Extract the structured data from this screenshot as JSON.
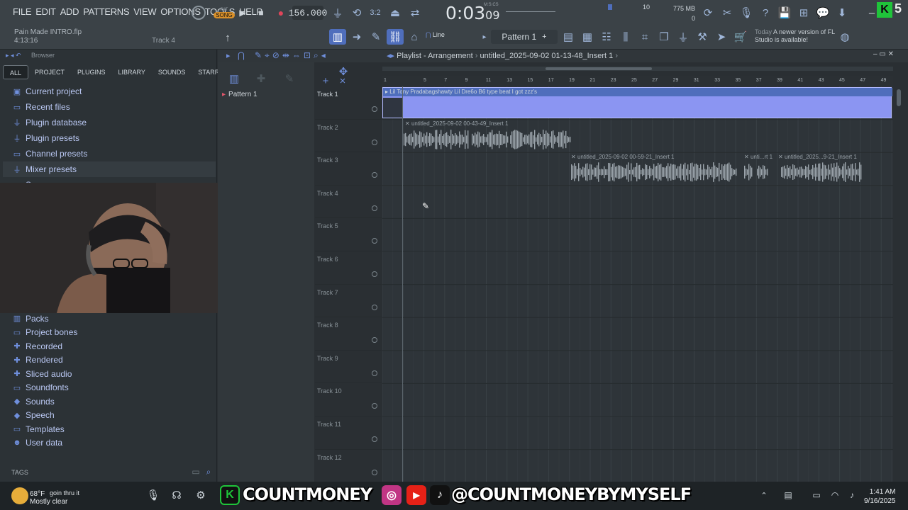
{
  "menu": [
    "FILE",
    "EDIT",
    "ADD",
    "PATTERNS",
    "VIEW",
    "OPTIONS",
    "TOOLS",
    "HELP"
  ],
  "song": {
    "file": "Pain Made INTRO.flp",
    "duration": "4:13:16",
    "hint": "Track 4"
  },
  "transport": {
    "mode_label": "SONG",
    "pat_label": "PAT",
    "tempo": "156.000",
    "time_main": "0:03",
    "time_sub": "09",
    "time_units": "M:S:CS"
  },
  "system": {
    "memory": "775 MB",
    "cpu": "10",
    "poly": "0"
  },
  "toolbar2": {
    "pattern_label": "Pattern 1",
    "snap_label": "Line"
  },
  "news": {
    "prefix": "Today",
    "text": "A newer version of FL Studio is available!"
  },
  "browser": {
    "title": "Browser",
    "tabs": [
      "ALL",
      "PROJECT",
      "PLUGINS",
      "LIBRARY",
      "SOUNDS",
      "STARRED"
    ],
    "top_items": [
      {
        "label": "Current project",
        "icon": "project-icon"
      },
      {
        "label": "Recent files",
        "icon": "folder-icon"
      },
      {
        "label": "Plugin database",
        "icon": "plugin-icon"
      },
      {
        "label": "Plugin presets",
        "icon": "plugin-icon"
      },
      {
        "label": "Channel presets",
        "icon": "folder-icon"
      },
      {
        "label": "Mixer presets",
        "icon": "plugin-icon"
      },
      {
        "label": "Scores",
        "icon": "folder-icon"
      }
    ],
    "bottom_items": [
      {
        "label": "Packs",
        "icon": "pack-icon"
      },
      {
        "label": "Project bones",
        "icon": "folder-icon"
      },
      {
        "label": "Recorded",
        "icon": "plus-icon"
      },
      {
        "label": "Rendered",
        "icon": "plus-icon"
      },
      {
        "label": "Sliced audio",
        "icon": "plus-icon"
      },
      {
        "label": "Soundfonts",
        "icon": "folder-icon"
      },
      {
        "label": "Sounds",
        "icon": "audio-icon"
      },
      {
        "label": "Speech",
        "icon": "audio-icon"
      },
      {
        "label": "Templates",
        "icon": "folder-icon"
      },
      {
        "label": "User data",
        "icon": "user-icon"
      }
    ],
    "tags_label": "TAGS"
  },
  "patterns": [
    {
      "label": "Pattern 1"
    }
  ],
  "playlist": {
    "title": "Playlist - Arrangement",
    "breadcrumb": "untitled_2025-09-02 01-13-48_Insert 1",
    "ruler": [
      "1",
      "5",
      "7",
      "9",
      "11",
      "13",
      "15",
      "17",
      "19",
      "21",
      "23",
      "25",
      "27",
      "29",
      "31",
      "33",
      "35",
      "37",
      "39",
      "41",
      "43",
      "45",
      "47",
      "49"
    ],
    "tracks": [
      "Track 1",
      "Track 2",
      "Track 3",
      "Track 4",
      "Track 5",
      "Track 6",
      "Track 7",
      "Track 8",
      "Track 9",
      "Track 10",
      "Track 11",
      "Track 12"
    ],
    "clips": {
      "clip1": "Lil Tony  Pradabagshawty  Lil Dre6o  B6 type beat I got zzz's",
      "clip2": "untitled_2025-09-02 00-43-49_Insert 1",
      "clip3": "untitled_2025-09-02 00-59-21_Insert 1",
      "clip4": "unti...rt 1",
      "clip5": "untitled_2025...9-21_Insert 1"
    }
  },
  "overlay": {
    "handle1": "COUNTMONEY",
    "handle2": "@COUNTMONEYBYMYSELF",
    "weather_temp": "68°F",
    "weather_cond": "Mostly clear",
    "notification": "goin thru it",
    "time": "1:41 AM",
    "date": "9/16/2025"
  },
  "colors": {
    "accent": "#4f6ebc",
    "clip_blue": "#8b95f2",
    "record_red": "#e0455a",
    "logo_green": "#1fc43a"
  }
}
